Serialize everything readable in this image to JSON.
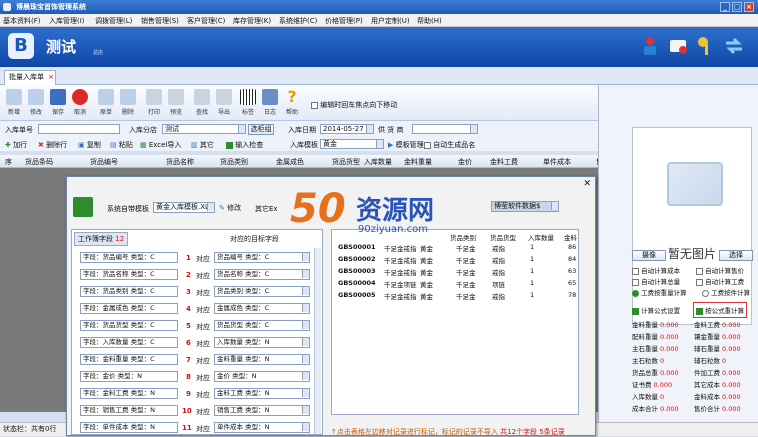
{
  "window": {
    "title": "博晨珠宝首饰管理系统",
    "min": "_",
    "max": "□",
    "close": "×"
  },
  "menu": [
    "基本资料(F)",
    "入库管理(I)",
    "调拨管理(L)",
    "销售管理(S)",
    "客户管理(C)",
    "库存管理(K)",
    "系统维护(C)",
    "价格管理(P)",
    "用户定制(U)",
    "帮助(H)"
  ],
  "banner": {
    "logo": "B",
    "name": "测试",
    "sub": "总店"
  },
  "tab": {
    "label": "批量入库单",
    "close": "×"
  },
  "toolbar": {
    "items": [
      "新增",
      "修改",
      "保存",
      "取消",
      "原单",
      "删除",
      "打印",
      "预览",
      "查找",
      "导出",
      "标签",
      "日志",
      "帮助"
    ],
    "check_label": "编辑时回车焦点向下移动"
  },
  "form": {
    "order_no_label": "入库单号",
    "order_no": "",
    "store_label": "入库分店",
    "store": "测试",
    "pick_store": "选柜组",
    "date_label": "入库日期",
    "date": "2014-05-27",
    "supplier_label": "供 货 商",
    "supplier": "",
    "add": "加行",
    "del": "删除行",
    "copy": "复制",
    "paste": "粘贴",
    "excel": "Excel导入",
    "other": "其它",
    "input_check": "输入检查",
    "template_label": "入库模板",
    "template": "黄金",
    "template_mgr": "模板管理",
    "auto_code": "自动生成品名"
  },
  "grid_headers": [
    "序",
    "货品条码",
    "货品编号",
    "货品名称",
    "货品类别",
    "金属成色",
    "货品货型",
    "入库数量",
    "金料重量",
    "金价",
    "金料工费",
    "单件成本",
    "售价"
  ],
  "dialog": {
    "sys_template_label": "系统自带模板",
    "sys_template": "黄金入库模板.XL",
    "modify": "修改",
    "other_ex": "其它Ex",
    "wm_select": "博莹软件数据$",
    "tab_label": "工作簿字段",
    "tab_count": "12",
    "target_label": "对应的目标字段",
    "dui": "对应",
    "fields": [
      {
        "src": "字段：货品编号  类型：C",
        "n": "1",
        "dst": "货品编号  类型：C"
      },
      {
        "src": "字段：货品名称  类型：C",
        "n": "2",
        "dst": "货品名称  类型：C"
      },
      {
        "src": "字段：货品类别  类型：C",
        "n": "3",
        "dst": "货品类别  类型：C"
      },
      {
        "src": "字段：金属成色  类型：C",
        "n": "4",
        "dst": "金属成色  类型：C"
      },
      {
        "src": "字段：货品货型  类型：C",
        "n": "5",
        "dst": "货品货型  类型：C"
      },
      {
        "src": "字段：入库数量  类型：C",
        "n": "6",
        "dst": "入库数量  类型：N"
      },
      {
        "src": "字段：金料重量  类型：C",
        "n": "7",
        "dst": "金料重量  类型：N"
      },
      {
        "src": "字段：金价  类型：N",
        "n": "8",
        "dst": "金价  类型：N"
      },
      {
        "src": "字段：金料工费  类型：N",
        "n": "9",
        "dst": "金料工费  类型：N"
      },
      {
        "src": "字段：销售工费  类型：N",
        "n": "10",
        "dst": "销售工费  类型：N"
      },
      {
        "src": "字段：单件成本  类型：N",
        "n": "11",
        "dst": "单件成本  类型：N"
      }
    ],
    "rhead": [
      "货品类别",
      "货品货型",
      "入库数量",
      "金料",
      "86"
    ],
    "rows": [
      [
        "GBS00001",
        "千足金戒指",
        "黄金",
        "千足金",
        "戒指",
        "1",
        "86"
      ],
      [
        "GBS00002",
        "千足金戒指",
        "黄金",
        "千足金",
        "戒指",
        "1",
        "84"
      ],
      [
        "GBS00003",
        "千足金戒指",
        "黄金",
        "千足金",
        "戒指",
        "1",
        "63"
      ],
      [
        "GBS00004",
        "千足金项链",
        "黄金",
        "千足金",
        "项链",
        "1",
        "65"
      ],
      [
        "GBS00005",
        "千足金戒指",
        "黄金",
        "千足金",
        "戒指",
        "1",
        "78"
      ]
    ],
    "footer": "↑点击表格左边移对记录进行标记，标记的记录不导入",
    "footer_count": "共12个字段",
    "footer_tail": "5条记录"
  },
  "watermark": {
    "logo": "50",
    "text": "资源网",
    "url": "90ziyuan.com"
  },
  "right": {
    "no_image": "暂无图片",
    "camera": "摄像",
    "pick": "选择",
    "checks": [
      "自动计算成本",
      "自动计算售价",
      "自动计算总量",
      "自动计算工费",
      "工费按重量计算",
      "工费按件计算"
    ],
    "formula_set": "计算公式设置",
    "formula_recalc": "按公式重计算",
    "stats": [
      [
        "金料重量",
        "0.000",
        "金料工费",
        "0.000"
      ],
      [
        "配料重量",
        "0.000",
        "镶金重量",
        "0.000"
      ],
      [
        "主石重量",
        "0.000",
        "辅石重量",
        "0.000"
      ],
      [
        "主石粒数",
        "0",
        "辅石粒数",
        "0"
      ],
      [
        "货品总重",
        "0.000",
        "件加工费",
        "0.000"
      ],
      [
        "证书费",
        "0.000",
        "其它成本",
        "0.000"
      ],
      [
        "入库数量",
        "0",
        "金料成本",
        "0.000"
      ],
      [
        "成本合计",
        "0.000",
        "售价合计",
        "0.000"
      ]
    ]
  },
  "status": {
    "text": "状态栏：共有0行"
  }
}
